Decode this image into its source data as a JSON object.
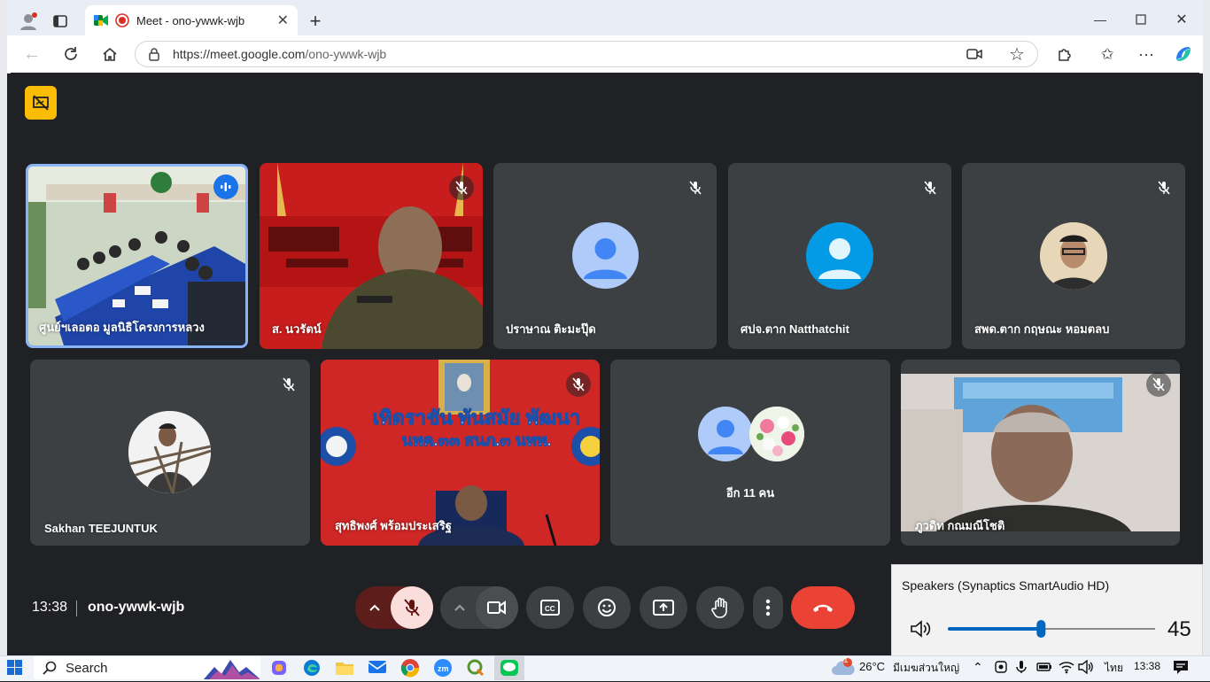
{
  "browser": {
    "tab_title": "Meet - ono-ywwk-wjb",
    "url_host": "https://meet.google.com",
    "url_path": "/ono-ywwk-wjb"
  },
  "meet": {
    "participants": [
      {
        "name": "ศูนย์ฯเลอตอ มูลนิธิโครงการหลวง",
        "state": "speaking"
      },
      {
        "name": "ส. นวรัตน์",
        "state": "muted"
      },
      {
        "name": "ปราษาณ ติะมะปุ๊ด",
        "state": "muted"
      },
      {
        "name": "ศปจ.ตาก Natthatchit",
        "state": "muted"
      },
      {
        "name": "สพด.ตาก กฤษณะ หอมตลบ",
        "state": "muted"
      },
      {
        "name": "Sakhan TEEJUNTUK",
        "state": "muted"
      },
      {
        "name": "สุทธิพงศ์ พร้อมประเสริฐ",
        "state": "muted"
      },
      {
        "name": "อีก 11 คน",
        "state": "group"
      },
      {
        "name": "ภูวดิท กณมณีโชติ",
        "state": "muted"
      }
    ],
    "banner_text_line1": "เทิดราชัน ทันสมัย พัฒนา",
    "banner_text_line2": "นพค.๓๓ สนภ.๓ นทพ.",
    "clock": "13:38",
    "meeting_code": "ono-ywwk-wjb"
  },
  "volume": {
    "device": "Speakers (Synaptics SmartAudio HD)",
    "level": 45
  },
  "taskbar": {
    "search_label": "Search",
    "weather_badge": "1",
    "temperature": "26°C",
    "weather_text": "มีเมฆส่วนใหญ่",
    "language": "ไทย",
    "time": "13:38"
  },
  "colors": {
    "meet_bg": "#202124",
    "tile_bg": "#3c4043",
    "end_call": "#ea4335",
    "active_border": "#8ab4f8",
    "present_badge": "#fbbc04",
    "volume_accent": "#0067c0"
  }
}
